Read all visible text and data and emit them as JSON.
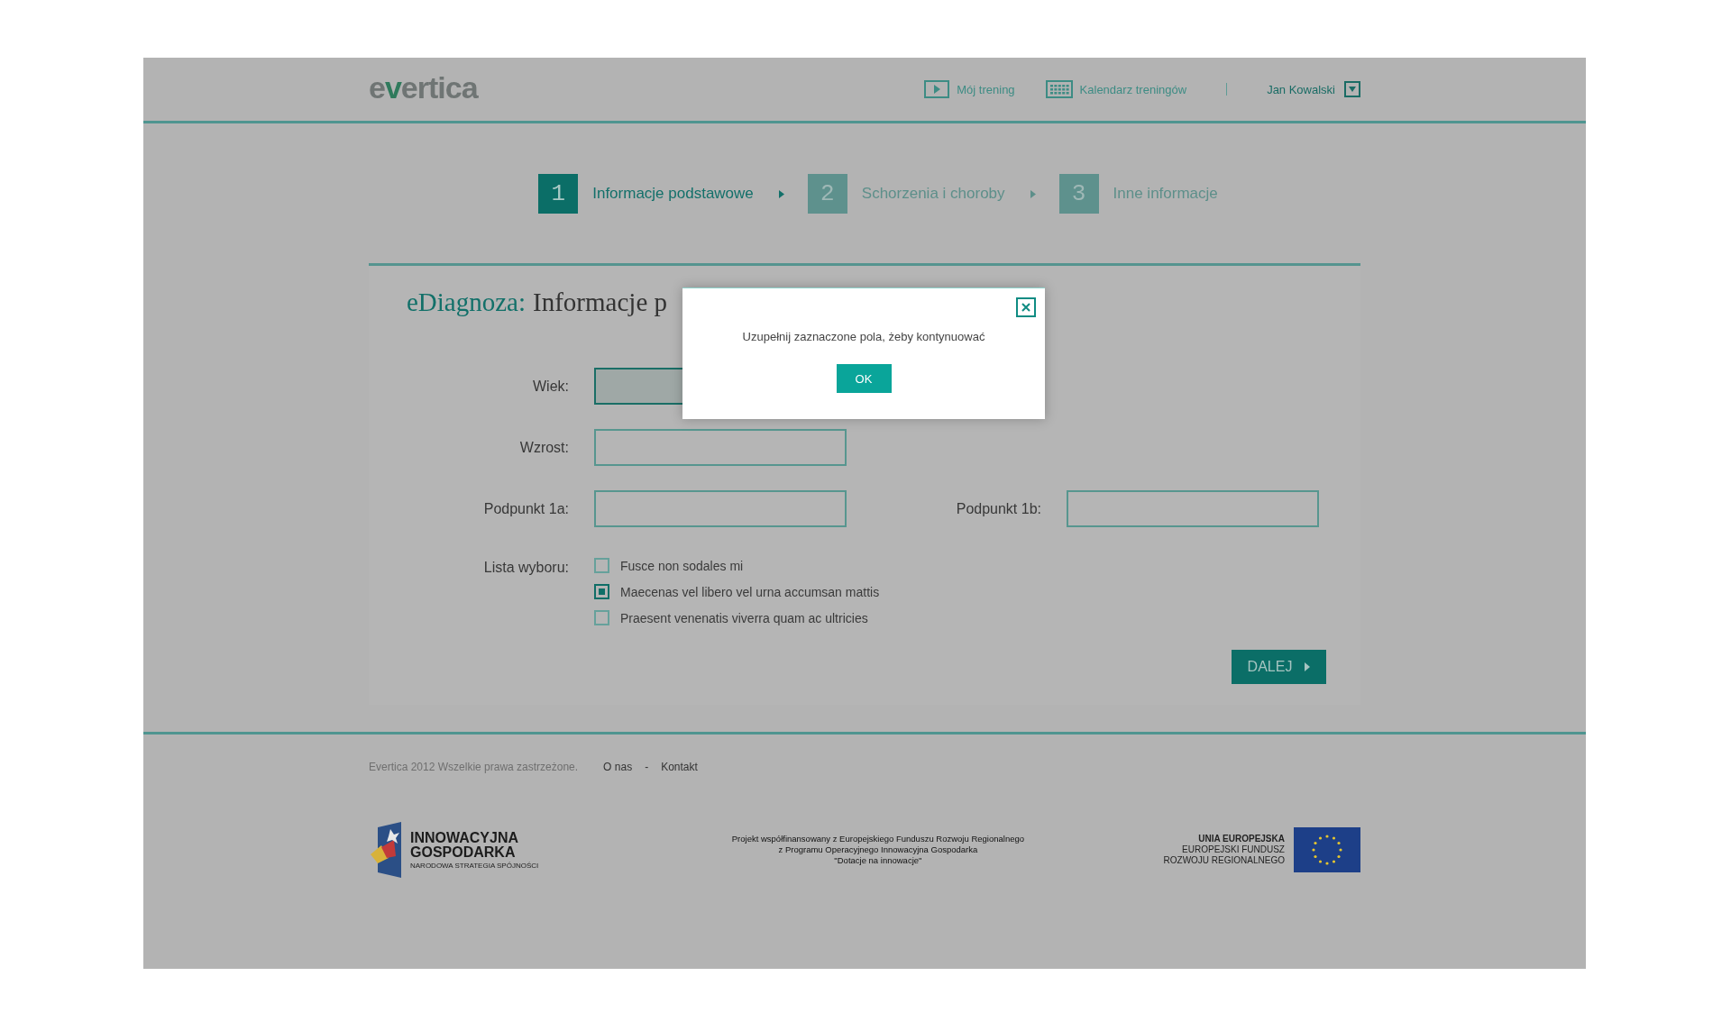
{
  "header": {
    "logo": "evertica",
    "nav": [
      {
        "label": "Mój trening"
      },
      {
        "label": "Kalendarz treningów"
      }
    ],
    "user": "Jan Kowalski"
  },
  "steps": [
    {
      "number": "1",
      "label": "Informacje podstawowe",
      "selected": true
    },
    {
      "number": "2",
      "label": "Schorzenia i choroby",
      "selected": false
    },
    {
      "number": "3",
      "label": "Inne informacje",
      "selected": false
    }
  ],
  "form": {
    "title_prefix": "eDiagnoza:",
    "title": "Informacje p",
    "rows": [
      {
        "fields": [
          {
            "label": "Wiek:",
            "highlighted": true
          }
        ]
      },
      {
        "fields": [
          {
            "label": "Wzrost:",
            "highlighted": false
          }
        ]
      },
      {
        "fields": [
          {
            "label": "Podpunkt 1a:",
            "highlighted": false
          },
          {
            "label": "Podpunkt 1b:",
            "highlighted": false
          }
        ]
      }
    ],
    "choice_label": "Lista wyboru:",
    "options": [
      {
        "label": "Fusce non sodales mi",
        "checked": false
      },
      {
        "label": "Maecenas vel libero vel urna accumsan mattis",
        "checked": true
      },
      {
        "label": "Praesent venenatis viverra quam ac ultricies",
        "checked": false
      }
    ],
    "next_button": "DALEJ"
  },
  "footer": {
    "copyright": "Evertica 2012 Wszelkie prawa zastrzeżone.",
    "links": [
      "O nas",
      "Kontakt"
    ],
    "separator": "-",
    "left_logo": [
      "INNOWACYJNA",
      "GOSPODARKA",
      "NARODOWA STRATEGIA SPÓJNOŚCI"
    ],
    "project_text": [
      "Projekt współfinansowany z Europejskiego Funduszu Rozwoju Regionalnego",
      "z Programu Operacyjnego Innowacyjna Gospodarka",
      "\"Dotacje na innowacje\""
    ],
    "right_logo": [
      "UNIA EUROPEJSKA",
      "EUROPEJSKI FUNDUSZ",
      "ROZWOJU REGIONALNEGO"
    ]
  },
  "modal": {
    "message": "Uzupełnij zaznaczone pola, żeby kontynuować",
    "button": "OK"
  }
}
